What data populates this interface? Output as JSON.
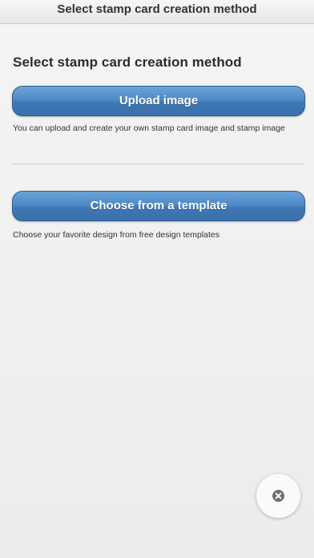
{
  "header": {
    "title": "Select stamp card creation method"
  },
  "main": {
    "title": "Select stamp card creation method",
    "options": [
      {
        "button_label": "Upload image",
        "description": "You can upload and create your own stamp card image and stamp image"
      },
      {
        "button_label": "Choose from a template",
        "description": "Choose your favorite design from free design templates"
      }
    ]
  },
  "fab": {
    "icon": "close-icon"
  }
}
